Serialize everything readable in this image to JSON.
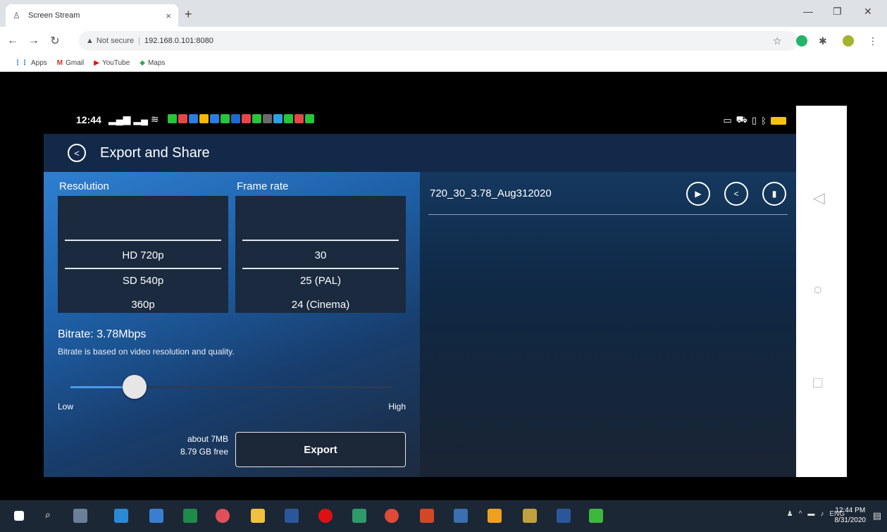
{
  "browser": {
    "tab_title": "Screen Stream",
    "tab_close": "×",
    "new_tab": "+",
    "address_warning": "Not secure",
    "url": "192.168.0.101:8080",
    "bookmarks": [
      {
        "label": "Apps"
      },
      {
        "label": "Gmail"
      },
      {
        "label": "YouTube"
      },
      {
        "label": "Maps"
      }
    ]
  },
  "phone_status": {
    "time": "12:44",
    "notification_colors": [
      "#26c53a",
      "#e64646",
      "#2a7de1",
      "#f5b800",
      "#2a7de1",
      "#26c53a",
      "#1b6ad6",
      "#e64646",
      "#26c53a",
      "#6a6a6a",
      "#2aa2e1",
      "#26c53a",
      "#e64646",
      "#26c53a"
    ]
  },
  "app": {
    "title": "Export and Share",
    "resolution": {
      "label": "Resolution",
      "options": [
        "HD 720p",
        "SD 540p",
        "360p"
      ]
    },
    "frame_rate": {
      "label": "Frame rate",
      "options": [
        "30",
        "25 (PAL)",
        "24 (Cinema)"
      ]
    },
    "bitrate": {
      "title": "Bitrate: 3.78Mbps",
      "description": "Bitrate is based on video resolution and quality.",
      "low_label": "Low",
      "high_label": "High",
      "slider_fraction": 0.2
    },
    "size_estimate": "about 7MB",
    "free_space": "8.79 GB free",
    "export_label": "Export",
    "file": {
      "name": "720_30_3.78_Aug312020"
    }
  },
  "taskbar": {
    "clock_time": "12:44 PM",
    "clock_date": "8/31/2020",
    "lang": "ENG"
  },
  "colors": {
    "accent": "#4a9be8",
    "app_bg": "#0f2440",
    "panel_blue": "#2f7fd1"
  }
}
